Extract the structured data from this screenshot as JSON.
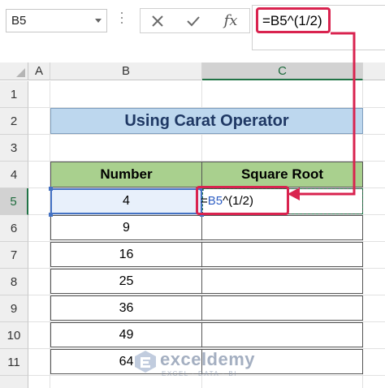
{
  "formula_bar": {
    "name_box": "B5",
    "cancel_icon": "close-icon",
    "enter_icon": "check-icon",
    "function_icon": "fx-icon",
    "function_label": "fx",
    "formula": "=B5^(1/2)"
  },
  "columns": [
    "A",
    "B",
    "C"
  ],
  "active_column": "C",
  "rows": [
    "1",
    "2",
    "3",
    "4",
    "5",
    "6",
    "7",
    "8",
    "9",
    "10",
    "11"
  ],
  "active_row": "5",
  "sheet": {
    "title": "Using Carat Operator",
    "headers": {
      "number": "Number",
      "square_root": "Square Root"
    },
    "numbers": [
      "4",
      "9",
      "16",
      "25",
      "36",
      "49",
      "64"
    ],
    "c5_entry": {
      "eq": "=",
      "ref": "B5",
      "rest": "^(1/2)"
    }
  },
  "watermark": {
    "name": "exceldemy",
    "tagline": "EXCEL · DATA · BI"
  },
  "colors": {
    "annotation": "#d9234f",
    "title_fill": "#bdd7ee",
    "header_fill": "#a9d08e",
    "selection": "#4472c4",
    "excel_green": "#217346"
  }
}
